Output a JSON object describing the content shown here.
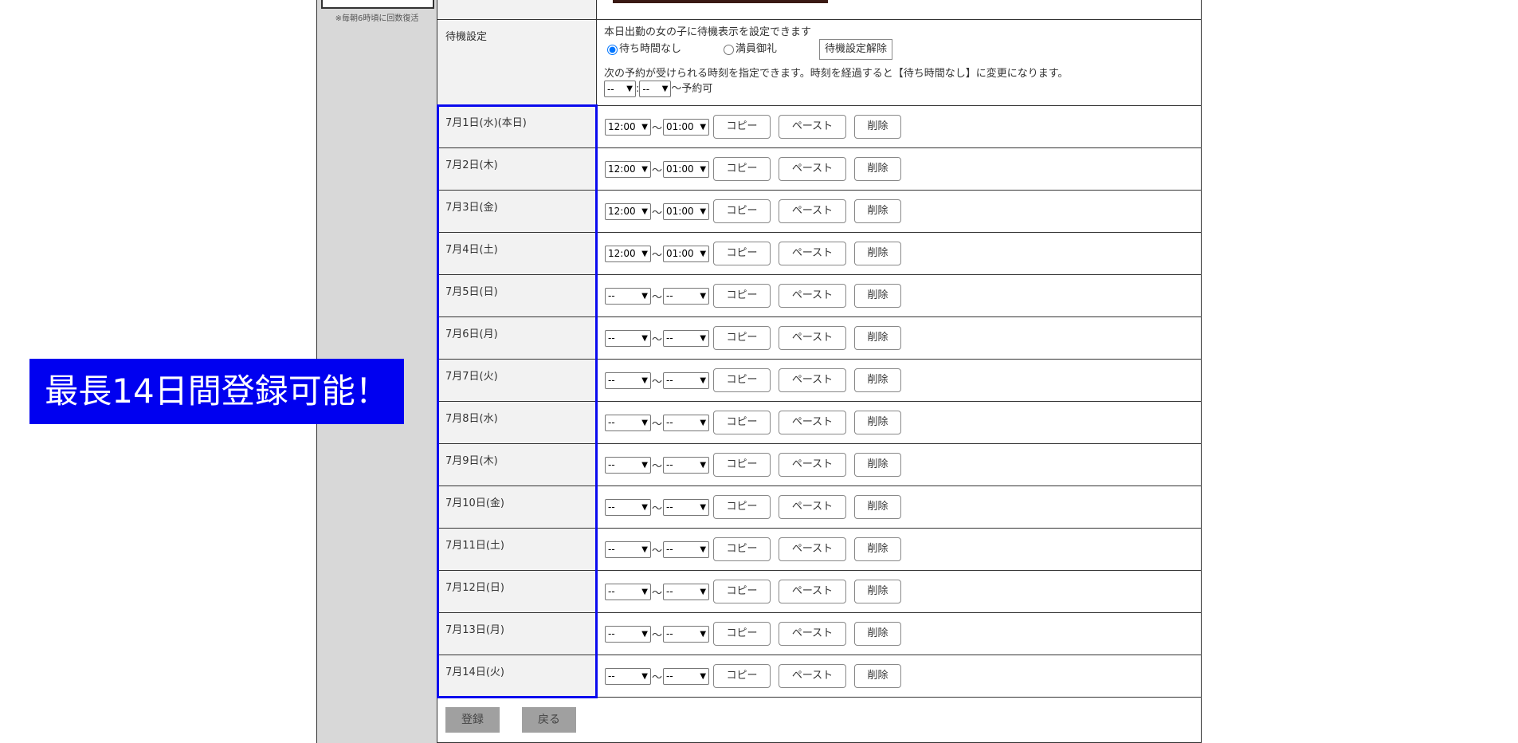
{
  "sidebar": {
    "note": "※毎朝6時頃に回数復活"
  },
  "standby": {
    "label": "待機設定",
    "description": "本日出勤の女の子に待機表示を設定できます",
    "options": [
      {
        "label": "待ち時間なし",
        "checked": true
      },
      {
        "label": "満員御礼",
        "checked": false
      }
    ],
    "clear_button": "待機設定解除",
    "next_note": "次の予約が受けられる時刻を指定できます。時刻を経過すると【待ち時間なし】に変更になります。",
    "hour_value": "--",
    "minute_value": "--",
    "colon": ":",
    "suffix": "〜予約可"
  },
  "schedule": {
    "tilde": "〜",
    "copy_label": "コピー",
    "paste_label": "ペースト",
    "delete_label": "削除",
    "days": [
      {
        "label": "7月1日(水)(本日)",
        "start": "12:00",
        "end": "01:00"
      },
      {
        "label": "7月2日(木)",
        "start": "12:00",
        "end": "01:00"
      },
      {
        "label": "7月3日(金)",
        "start": "12:00",
        "end": "01:00"
      },
      {
        "label": "7月4日(土)",
        "start": "12:00",
        "end": "01:00"
      },
      {
        "label": "7月5日(日)",
        "start": "--",
        "end": "--"
      },
      {
        "label": "7月6日(月)",
        "start": "--",
        "end": "--"
      },
      {
        "label": "7月7日(火)",
        "start": "--",
        "end": "--"
      },
      {
        "label": "7月8日(水)",
        "start": "--",
        "end": "--"
      },
      {
        "label": "7月9日(木)",
        "start": "--",
        "end": "--"
      },
      {
        "label": "7月10日(金)",
        "start": "--",
        "end": "--"
      },
      {
        "label": "7月11日(土)",
        "start": "--",
        "end": "--"
      },
      {
        "label": "7月12日(日)",
        "start": "--",
        "end": "--"
      },
      {
        "label": "7月13日(月)",
        "start": "--",
        "end": "--"
      },
      {
        "label": "7月14日(火)",
        "start": "--",
        "end": "--"
      }
    ]
  },
  "footer": {
    "register_label": "登録",
    "back_label": "戻る"
  },
  "banner": {
    "text": "最長14日間登録可能！",
    "color": "#0000f0"
  },
  "colors": {
    "highlight_outline": "#0a0aee",
    "label_bg": "#f2f2f2",
    "sidebar_bg": "#d8d8d8"
  }
}
